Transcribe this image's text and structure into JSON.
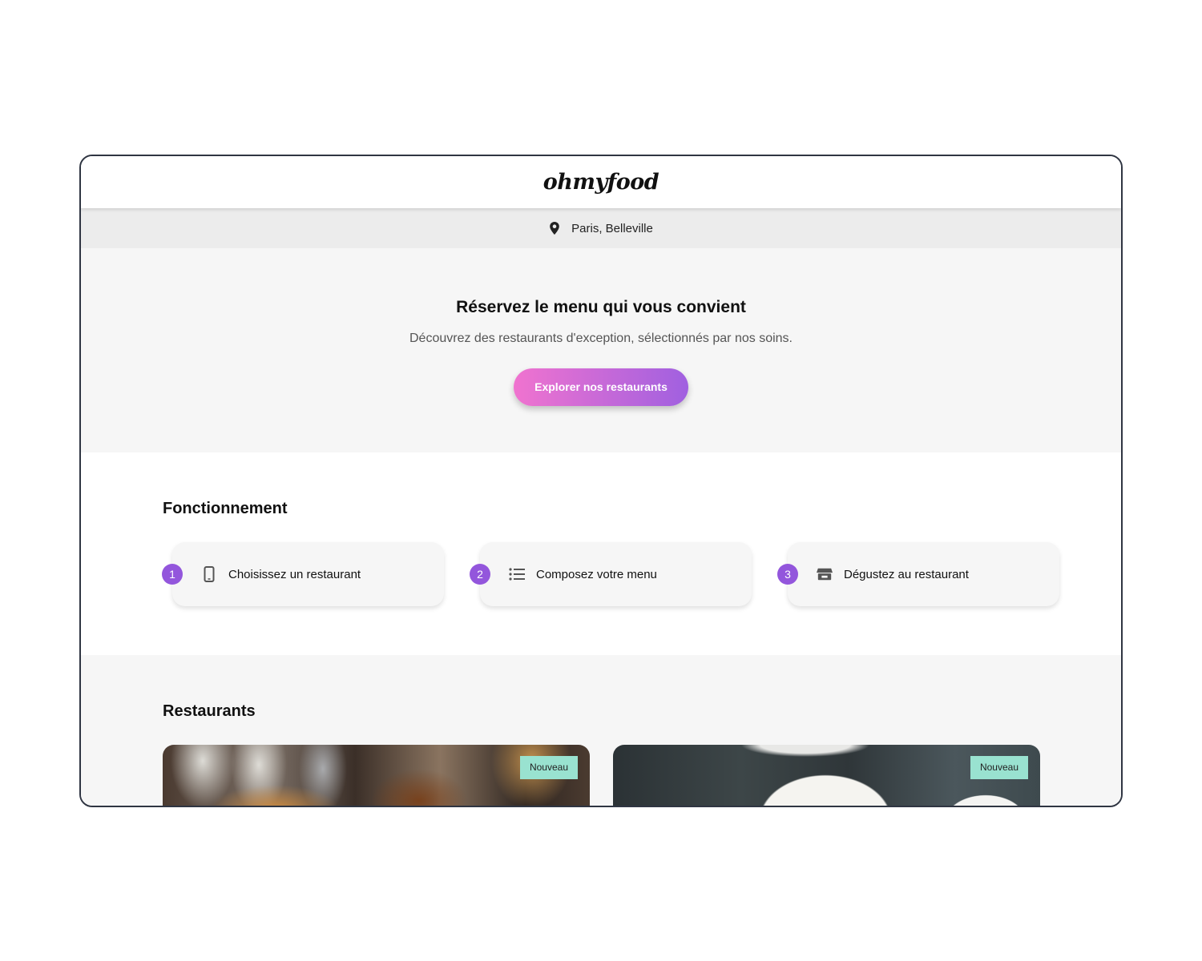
{
  "header": {
    "logo": "ohmyfood"
  },
  "location": {
    "text": "Paris, Belleville",
    "icon": "map-pin-icon"
  },
  "hero": {
    "title": "Réservez le menu qui vous convient",
    "subtitle": "Découvrez des restaurants d'exception, sélectionnés par nos soins.",
    "cta_label": "Explorer nos restaurants"
  },
  "how": {
    "title": "Fonctionnement",
    "steps": [
      {
        "number": "1",
        "icon": "smartphone-icon",
        "label": "Choisissez un restaurant"
      },
      {
        "number": "2",
        "icon": "list-icon",
        "label": "Composez votre menu"
      },
      {
        "number": "3",
        "icon": "store-icon",
        "label": "Dégustez au restaurant"
      }
    ]
  },
  "restaurants": {
    "title": "Restaurants",
    "cards": [
      {
        "badge": "Nouveau"
      },
      {
        "badge": "Nouveau"
      }
    ]
  },
  "colors": {
    "accent_purple": "#9356dc",
    "cta_gradient_start": "#f073cf",
    "cta_gradient_end": "#a060e0",
    "badge_green": "#99e2d0"
  }
}
